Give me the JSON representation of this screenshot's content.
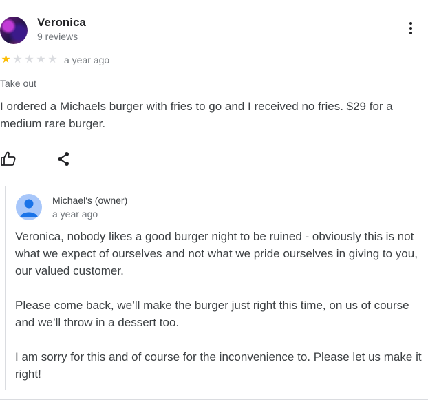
{
  "review": {
    "reviewer_name": "Veronica",
    "review_count": "9 reviews",
    "rating": 1,
    "rating_max": 5,
    "time": "a year ago",
    "service_type": "Take out",
    "text": "I ordered a Michaels burger with fries to go and I received no fries. $29 for a medium rare burger.",
    "actions": {
      "like_icon": "thumb-up-icon",
      "share_icon": "share-icon",
      "more_icon": "more-vert-icon"
    }
  },
  "owner_reply": {
    "name": "Michael's (owner)",
    "time": "a year ago",
    "paragraphs": [
      "Veronica, nobody likes a good burger night to be ruined - obviously this is not what we expect of ourselves and not what we pride ourselves in giving to you, our valued customer.",
      "Please come back, we’ll make the burger just right this time, on us of course and we’ll throw in a dessert too.",
      "I am sorry for this and of course for the inconvenience to. Please let us make it right!"
    ]
  },
  "colors": {
    "star_filled": "#fbbc04",
    "star_empty": "#dadce0",
    "owner_avatar": "#a8c7fa"
  }
}
